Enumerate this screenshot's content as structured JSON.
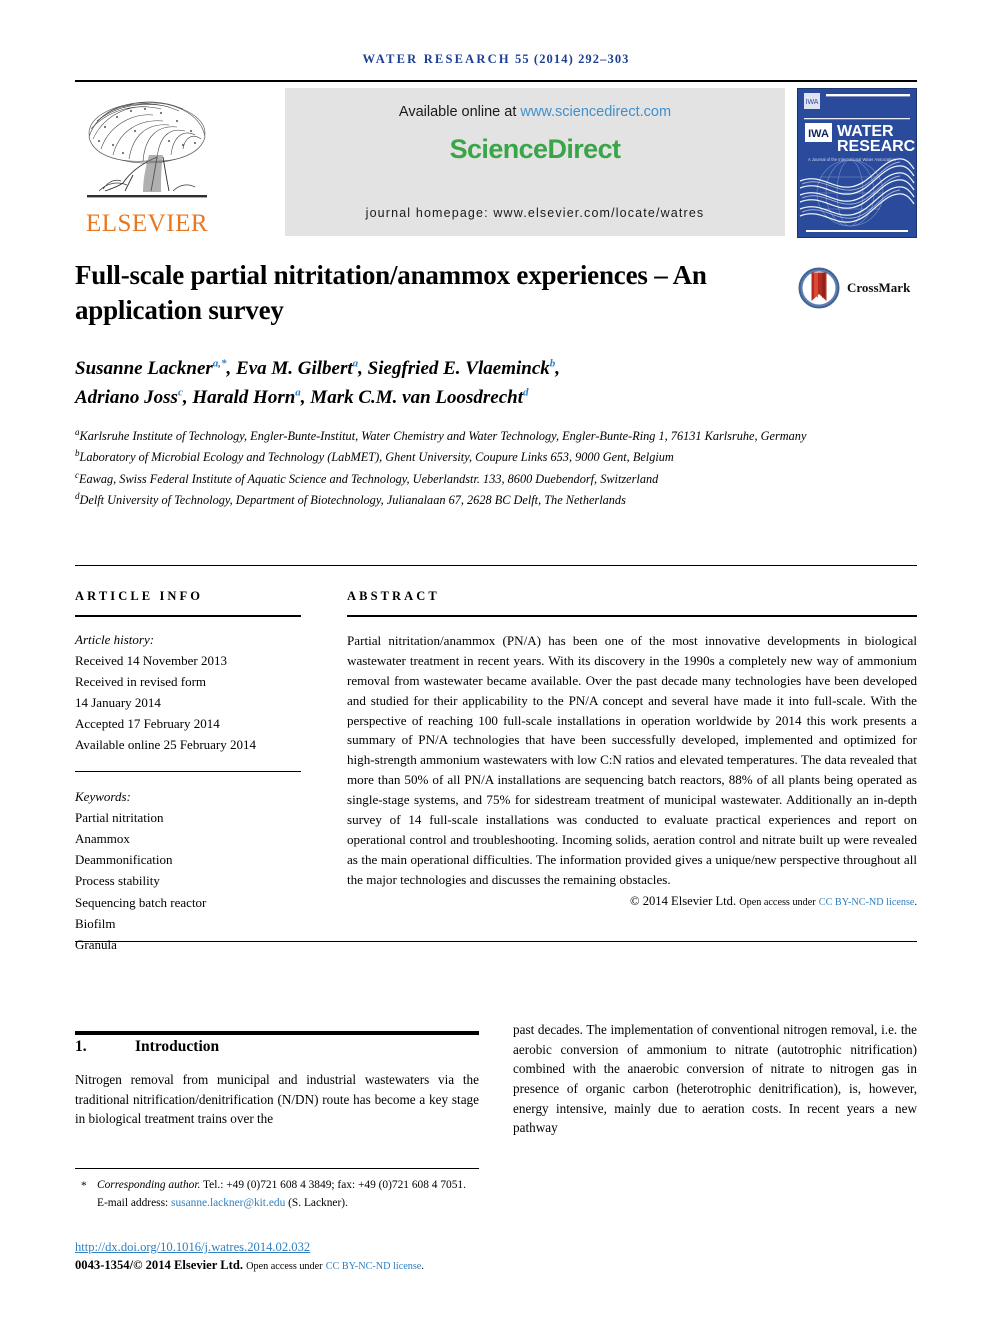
{
  "running_head": {
    "journal": "WATER RESEARCH",
    "citation": "55 (2014) 292–303"
  },
  "masthead": {
    "publisher_logo_text": "ELSEVIER",
    "available_label": "Available online at",
    "available_url": "www.sciencedirect.com",
    "sciencedirect_part1": "Science",
    "sciencedirect_part2": "Direct",
    "homepage_line": "journal homepage: www.elsevier.com/locate/watres",
    "cover_title_line1": "WATER",
    "cover_title_line2": "RESEARCH",
    "cover_subtitle": "A Journal of the International Water Association",
    "cover_badge": "IWA"
  },
  "article": {
    "title": "Full-scale partial nitritation/anammox experiences – An application survey",
    "crossmark_label": "CrossMark",
    "authors_line1": "Susanne Lackner a,*, Eva M. Gilbert a, Siegfried E. Vlaeminck b,",
    "authors_line2": "Adriano Joss c, Harald Horn a, Mark C.M. van Loosdrecht d",
    "affiliations": [
      {
        "marker": "a",
        "text": "Karlsruhe Institute of Technology, Engler-Bunte-Institut, Water Chemistry and Water Technology, Engler-Bunte-Ring 1, 76131 Karlsruhe, Germany"
      },
      {
        "marker": "b",
        "text": "Laboratory of Microbial Ecology and Technology (LabMET), Ghent University, Coupure Links 653, 9000 Gent, Belgium"
      },
      {
        "marker": "c",
        "text": "Eawag, Swiss Federal Institute of Aquatic Science and Technology, Ueberlandstr. 133, 8600 Duebendorf, Switzerland"
      },
      {
        "marker": "d",
        "text": "Delft University of Technology, Department of Biotechnology, Julianalaan 67, 2628 BC Delft, The Netherlands"
      }
    ]
  },
  "article_info": {
    "heading": "ARTICLE INFO",
    "history_label": "Article history:",
    "history": [
      "Received 14 November 2013",
      "Received in revised form",
      "14 January 2014",
      "Accepted 17 February 2014",
      "Available online 25 February 2014"
    ],
    "keywords_label": "Keywords:",
    "keywords": [
      "Partial nitritation",
      "Anammox",
      "Deammonification",
      "Process stability",
      "Sequencing batch reactor",
      "Biofilm",
      "Granula"
    ]
  },
  "abstract": {
    "heading": "ABSTRACT",
    "text": "Partial nitritation/anammox (PN/A) has been one of the most innovative developments in biological wastewater treatment in recent years. With its discovery in the 1990s a completely new way of ammonium removal from wastewater became available. Over the past decade many technologies have been developed and studied for their applicability to the PN/A concept and several have made it into full-scale. With the perspective of reaching 100 full-scale installations in operation worldwide by 2014 this work presents a summary of PN/A technologies that have been successfully developed, implemented and optimized for high-strength ammonium wastewaters with low C:N ratios and elevated temperatures. The data revealed that more than 50% of all PN/A installations are sequencing batch reactors, 88% of all plants being operated as single-stage systems, and 75% for sidestream treatment of municipal wastewater. Additionally an in-depth survey of 14 full-scale installations was conducted to evaluate practical experiences and report on operational control and troubleshooting. Incoming solids, aeration control and nitrate built up were revealed as the main operational difficulties. The information provided gives a unique/new perspective throughout all the major technologies and discusses the remaining obstacles.",
    "copyright": "© 2014 Elsevier Ltd.",
    "open_access_prefix": "Open access under",
    "license_link": "CC BY-NC-ND license",
    "license_suffix": "."
  },
  "body": {
    "section_number": "1.",
    "section_title": "Introduction",
    "left_column": "Nitrogen removal from municipal and industrial wastewaters via the traditional nitrification/denitrification (N/DN) route has become a key stage in biological treatment trains over the",
    "right_column": "past decades. The implementation of conventional nitrogen removal, i.e. the aerobic conversion of ammonium to nitrate (autotrophic nitrification) combined with the anaerobic conversion of nitrate to nitrogen gas in presence of organic carbon (heterotrophic denitrification), is, however, energy intensive, mainly due to aeration costs. In recent years a new pathway"
  },
  "footer": {
    "corresponding_star": "*",
    "corresponding_label": "Corresponding author.",
    "corresponding_contact": " Tel.: +49 (0)721 608 4 3849; fax: +49 (0)721 608 4 7051.",
    "email_label": "E-mail address:",
    "email": "susanne.lackner@kit.edu",
    "email_owner": "(S. Lackner).",
    "doi": "http://dx.doi.org/10.1016/j.watres.2014.02.032",
    "issn_line": "0043-1354/© 2014 Elsevier Ltd.",
    "issn_open_access": "Open access under",
    "issn_license": "CC BY-NC-ND license",
    "issn_suffix": "."
  },
  "colors": {
    "runhead_blue": "#1c3f94",
    "link_blue": "#2f7fc1",
    "sciencedirect_green": "#3aa548",
    "elsevier_orange": "#e87722",
    "cover_blue": "#2a4b9b",
    "panel_gray": "#e3e3e3"
  }
}
